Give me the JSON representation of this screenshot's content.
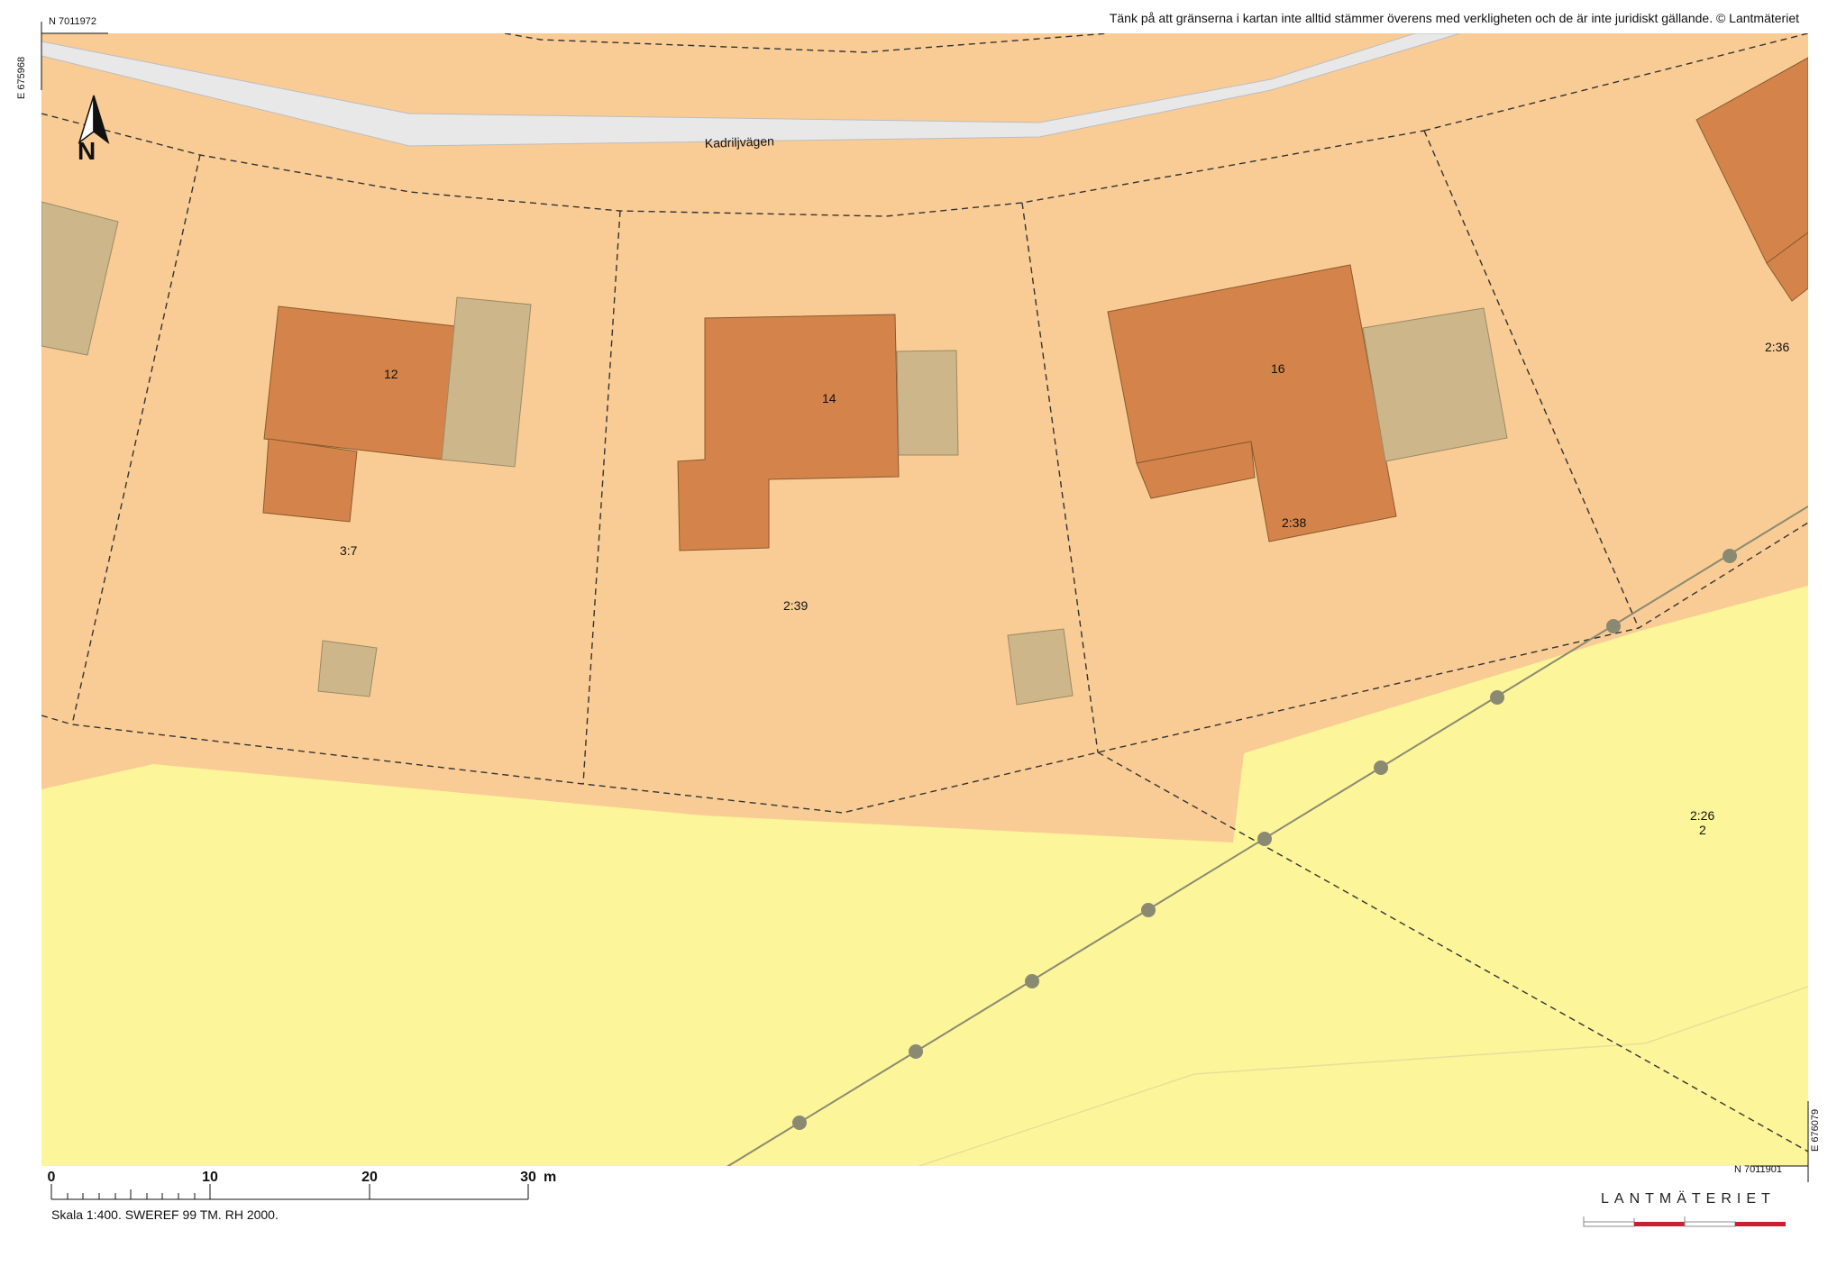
{
  "disclaimer": "Tänk på att gränserna i kartan inte alltid stämmer överens med verkligheten och de är inte juridiskt gällande. © Lantmäteriet",
  "coordinates": {
    "north_top": "N 7011972",
    "east_top": "E 675968",
    "north_bottom": "N 7011901",
    "east_bottom": "E 676079"
  },
  "north_arrow": {
    "label": "N"
  },
  "road": {
    "name": "Kadriljvägen"
  },
  "buildings": [
    {
      "label": "12"
    },
    {
      "label": "14"
    },
    {
      "label": "16"
    }
  ],
  "parcels": [
    {
      "label": "3:7"
    },
    {
      "label": "2:39"
    },
    {
      "label": "2:38"
    },
    {
      "label": "2:36"
    },
    {
      "label": "2:26",
      "sublabel": "2"
    }
  ],
  "scale_bar": {
    "ticks": [
      "0",
      "10",
      "20",
      "30"
    ],
    "unit": "m",
    "caption": "Skala 1:400. SWEREF 99 TM. RH 2000."
  },
  "brand": "LANTMÄTERIET",
  "colors": {
    "residential": "#f9cc95",
    "open_land": "#fcf59a",
    "building_main": "#d4844a",
    "building_secondary": "#cdb78a",
    "road_fill": "#e8e8e8",
    "powerline": "#8a8a72",
    "brand_red": "#c8202f"
  }
}
